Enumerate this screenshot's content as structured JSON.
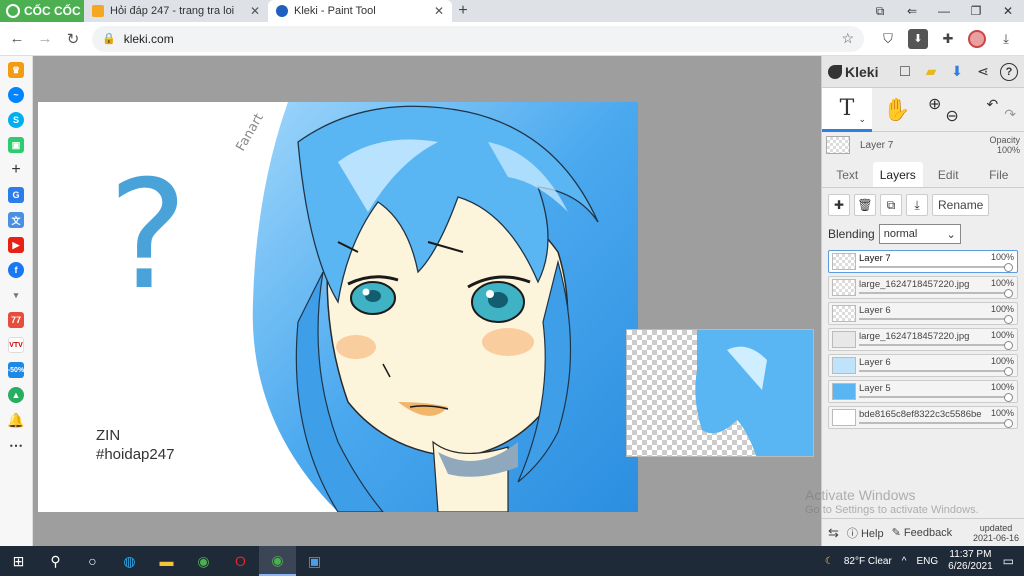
{
  "browser": {
    "brand": "CỐC CỐC",
    "tabs": [
      {
        "title": "Hỏi đáp 247 - trang tra loi",
        "favicon_color": "#f5a623"
      },
      {
        "title": "Kleki - Paint Tool",
        "favicon_color": "#1f5fbf"
      }
    ],
    "new_tab": "+",
    "url": "kleki.com"
  },
  "artwork": {
    "question_mark": "?",
    "signature": "Fanart",
    "author_line1": "ZIN",
    "author_line2": "#hoidap247",
    "colors": {
      "hair": "#4aa8ee",
      "skin": "#fdf4dc",
      "eye": "#3fb2c4",
      "blush": "#f7c38d"
    }
  },
  "kleki": {
    "logo": "Kleki",
    "current_layer": {
      "name": "Layer 7",
      "opacity_label": "Opacity",
      "opacity": "100%"
    },
    "tabs": [
      "Text",
      "Layers",
      "Edit",
      "File"
    ],
    "active_tab": "Layers",
    "rename_label": "Rename",
    "blending_label": "Blending",
    "blending_value": "normal",
    "layers": [
      {
        "name": "Layer 7",
        "opacity": "100%"
      },
      {
        "name": "large_1624718457220.jpg",
        "opacity": "100%"
      },
      {
        "name": "Layer 6",
        "opacity": "100%"
      },
      {
        "name": "large_1624718457220.jpg",
        "opacity": "100%"
      },
      {
        "name": "Layer 6",
        "opacity": "100%"
      },
      {
        "name": "Layer 5",
        "opacity": "100%"
      },
      {
        "name": "bde8165c8ef8322c3c5586be",
        "opacity": "100%"
      }
    ],
    "footer": {
      "help": "Help",
      "feedback": "Feedback",
      "updated_label": "updated",
      "updated_date": "2021-06-16"
    }
  },
  "watermark": {
    "title": "Activate Windows",
    "subtitle": "Go to Settings to activate Windows."
  },
  "taskbar": {
    "weather": "82°F  Clear",
    "lang": "ENG",
    "time": "11:37 PM",
    "date": "6/26/2021"
  }
}
